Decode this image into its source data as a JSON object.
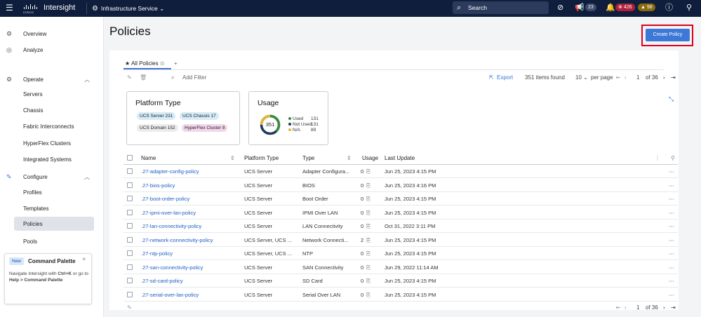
{
  "topbar": {
    "brand": "Intersight",
    "service": "Infrastructure Service",
    "search": "Search",
    "notif_count": "23",
    "critical_count": "426",
    "warning_count": "98",
    "cisco_word": "CISCO"
  },
  "sidebar": {
    "items": [
      {
        "label": "Overview"
      },
      {
        "label": "Analyze"
      },
      {
        "label": "Operate"
      },
      {
        "label": "Servers"
      },
      {
        "label": "Chassis"
      },
      {
        "label": "Fabric Interconnects"
      },
      {
        "label": "HyperFlex Clusters"
      },
      {
        "label": "Integrated Systems"
      },
      {
        "label": "Configure"
      },
      {
        "label": "Profiles"
      },
      {
        "label": "Templates"
      },
      {
        "label": "Policies"
      },
      {
        "label": "Pools"
      }
    ]
  },
  "command_palette": {
    "badge": "New",
    "title": "Command Palette",
    "close": "×",
    "desc_1": "Navigate Intersight with ",
    "key_1": "Ctrl+K",
    "desc_2": " or go to ",
    "path": "Help > Command Palette"
  },
  "page": {
    "title": "Policies",
    "create_label": "Create Policy"
  },
  "tabs": {
    "active": "All Policies",
    "add": "+"
  },
  "toolbar": {
    "add_filter": "Add Filter",
    "export": "Export",
    "items_found": "351 items found",
    "page_size": "10",
    "per_page": "per page",
    "page": "1",
    "of_pages": "of 36"
  },
  "platform_widget": {
    "title": "Platform Type",
    "chips": [
      "UCS Server 231",
      "UCS Chassis 17",
      "UCS Domain 152",
      "HyperFlex Cluster 8"
    ]
  },
  "usage_widget": {
    "title": "Usage",
    "total": "351",
    "legend": [
      {
        "label": "Used",
        "value": "131",
        "color": "#3a8a3a"
      },
      {
        "label": "Not Used",
        "value": "131",
        "color": "#1f3a5a"
      },
      {
        "label": "N/A",
        "value": "89",
        "color": "#e0b73a"
      }
    ]
  },
  "table": {
    "headers": [
      "Name",
      "Platform Type",
      "Type",
      "Usage",
      "Last Update"
    ],
    "rows": [
      {
        "name": ".27-adapter-config-policy",
        "platform": "UCS Server",
        "type": "Adapter Configura...",
        "usage": "0",
        "updated": "Jun 25, 2023 4:15 PM"
      },
      {
        "name": ".27-bios-policy",
        "platform": "UCS Server",
        "type": "BIOS",
        "usage": "0",
        "updated": "Jun 25, 2023 4:16 PM"
      },
      {
        "name": ".27-boot-order-policy",
        "platform": "UCS Server",
        "type": "Boot Order",
        "usage": "0",
        "updated": "Jun 25, 2023 4:15 PM"
      },
      {
        "name": ".27-ipmi-over-lan-policy",
        "platform": "UCS Server",
        "type": "IPMI Over LAN",
        "usage": "0",
        "updated": "Jun 25, 2023 4:15 PM"
      },
      {
        "name": ".27-lan-connectivity-policy",
        "platform": "UCS Server",
        "type": "LAN Connectivity",
        "usage": "0",
        "updated": "Oct 31, 2022 3:11 PM"
      },
      {
        "name": ".27-network-connectivity-policy",
        "platform": "UCS Server, UCS ...",
        "type": "Network Connecti...",
        "usage": "2",
        "updated": "Jun 25, 2023 4:15 PM"
      },
      {
        "name": ".27-ntp-policy",
        "platform": "UCS Server, UCS ...",
        "type": "NTP",
        "usage": "0",
        "updated": "Jun 25, 2023 4:15 PM"
      },
      {
        "name": ".27-san-connectivity-policy",
        "platform": "UCS Server",
        "type": "SAN Connectivity",
        "usage": "0",
        "updated": "Jun 29, 2022 11:14 AM"
      },
      {
        "name": ".27-sd-card-policy",
        "platform": "UCS Server",
        "type": "SD Card",
        "usage": "0",
        "updated": "Jun 25, 2023 4:15 PM"
      },
      {
        "name": ".27-serial-over-lan-policy",
        "platform": "UCS Server",
        "type": "Serial Over LAN",
        "usage": "0",
        "updated": "Jun 25, 2023 4:15 PM"
      }
    ]
  },
  "footer_pager": {
    "page": "1",
    "of_pages": "of 36"
  }
}
